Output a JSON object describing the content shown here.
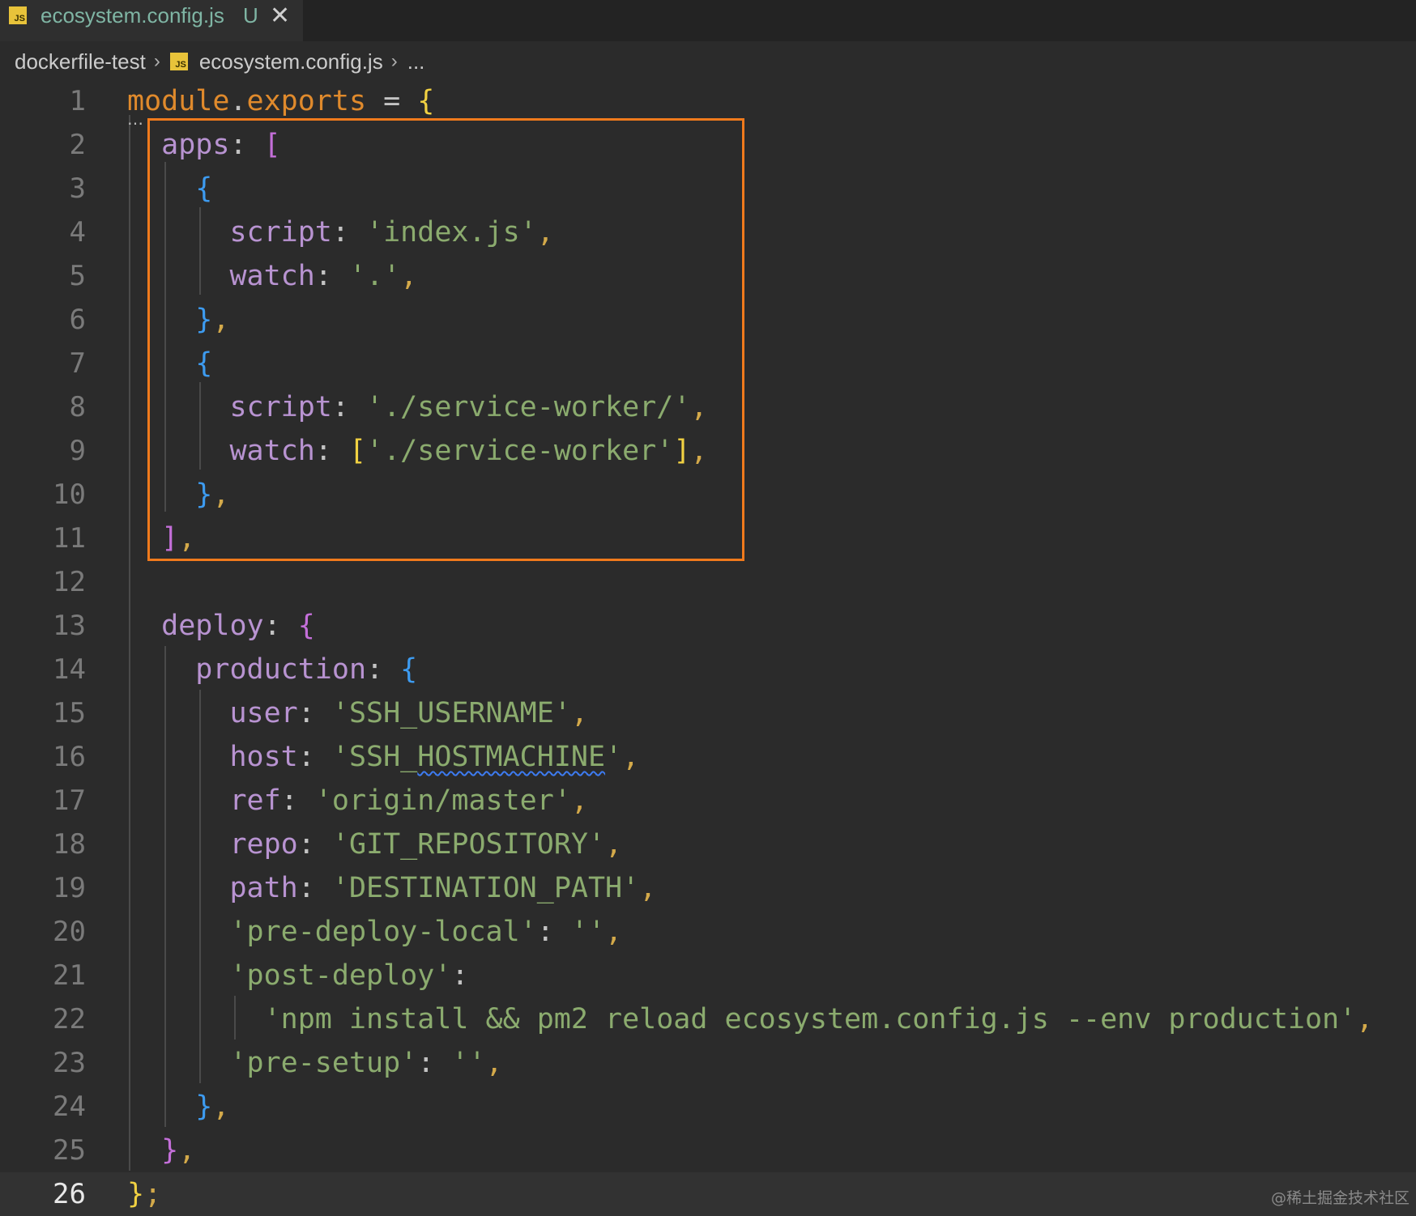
{
  "tab": {
    "icon": "JS",
    "title": "ecosystem.config.js",
    "status": "U",
    "close_glyph": "✕"
  },
  "breadcrumb": {
    "folder": "dockerfile-test",
    "file": "ecosystem.config.js",
    "more": "..."
  },
  "editor": {
    "line_numbers": [
      "1",
      "2",
      "3",
      "4",
      "5",
      "6",
      "7",
      "8",
      "9",
      "10",
      "11",
      "12",
      "13",
      "14",
      "15",
      "16",
      "17",
      "18",
      "19",
      "20",
      "21",
      "22",
      "23",
      "24",
      "25",
      "26"
    ],
    "current_line": 26,
    "highlight_color": "#f07a1c"
  },
  "watermark": "@稀土掘金技术社区"
}
